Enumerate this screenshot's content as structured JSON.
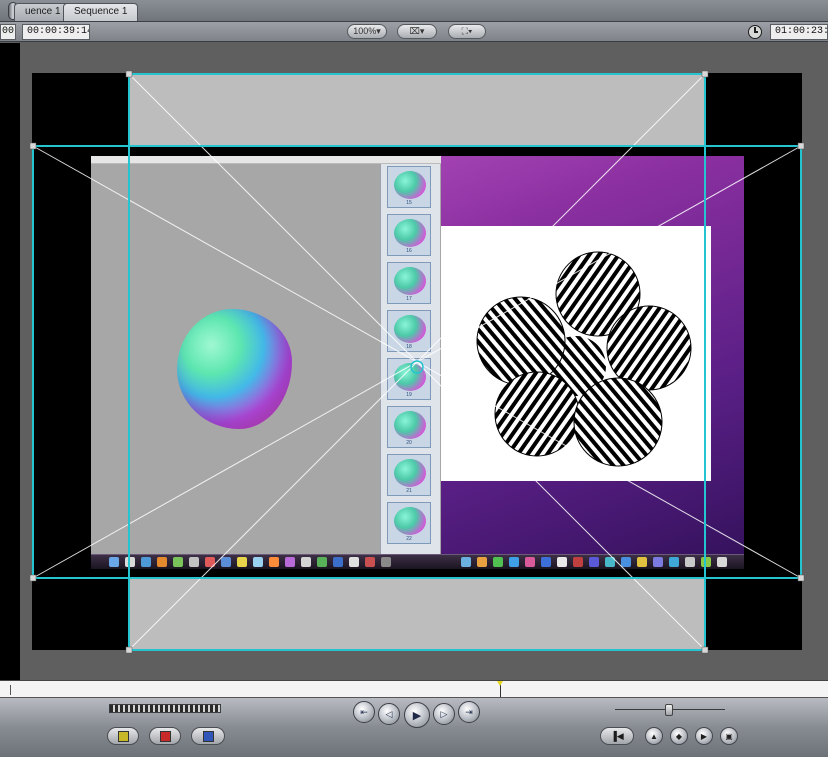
{
  "tabs": [
    {
      "label": "uence 1",
      "active": false
    },
    {
      "label": "Sequence 1",
      "active": true
    }
  ],
  "toolbar": {
    "left_edge_text": "00",
    "current_timecode": "00:00:39:14",
    "zoom_label": "100%",
    "view_label": "",
    "overlay_label": "",
    "duration_timecode": "01:00:23:1"
  },
  "thumbnails": [
    "15",
    "16",
    "17",
    "18",
    "19",
    "20",
    "21",
    "22"
  ],
  "transport": {
    "go_to_in": "⇤",
    "step_back": "◁",
    "play": "▶",
    "step_forward": "▷",
    "go_to_out": "⇥"
  },
  "marker_buttons": {
    "mark_in": "▣",
    "mark_out": "▣",
    "mark_clip": "▣"
  },
  "right_buttons": [
    "◆",
    "▲",
    "◆",
    "▶",
    "▣"
  ],
  "colors": {
    "wireframe": "#24c4d0",
    "guide_lines": "#ffffff",
    "playhead_marker": "#e6d81c",
    "background": "#5f5f5f",
    "video_black": "#000000",
    "overscan_grey": "#bdbdbd"
  },
  "icons": [
    "clock-icon",
    "playhead-marker-icon",
    "marker-icon"
  ]
}
